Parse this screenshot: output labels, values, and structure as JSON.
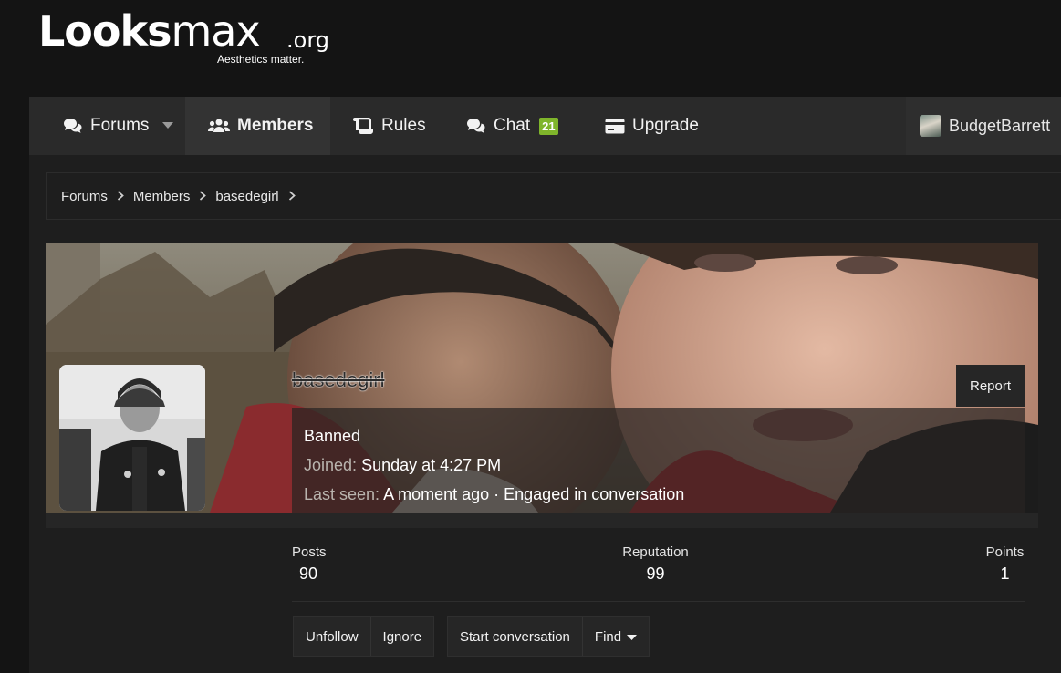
{
  "logo": {
    "word_bold": "Looks",
    "word_thin": "max",
    "tld": ".org",
    "tagline": "Aesthetics matter."
  },
  "nav": {
    "forums": "Forums",
    "members": "Members",
    "rules": "Rules",
    "chat": "Chat",
    "chat_badge": "21",
    "upgrade": "Upgrade",
    "username": "BudgetBarrett",
    "active_item": "members"
  },
  "breadcrumb": [
    "Forums",
    "Members",
    "basedegirl"
  ],
  "profile": {
    "username": "basedegirl",
    "report_label": "Report",
    "status": "Banned",
    "joined_label": "Joined:",
    "joined_value": "Sunday at 4:27 PM",
    "last_seen_label": "Last seen:",
    "last_seen_value": "A moment ago · Engaged in conversation"
  },
  "stats": {
    "posts_label": "Posts",
    "posts_value": "90",
    "reputation_label": "Reputation",
    "reputation_value": "99",
    "points_label": "Points",
    "points_value": "1"
  },
  "actions": {
    "unfollow": "Unfollow",
    "ignore": "Ignore",
    "start_conversation": "Start conversation",
    "find": "Find"
  },
  "colors": {
    "background": "#141414",
    "navbar": "#2a2a2a",
    "chat_badge": "#7fb52b"
  }
}
